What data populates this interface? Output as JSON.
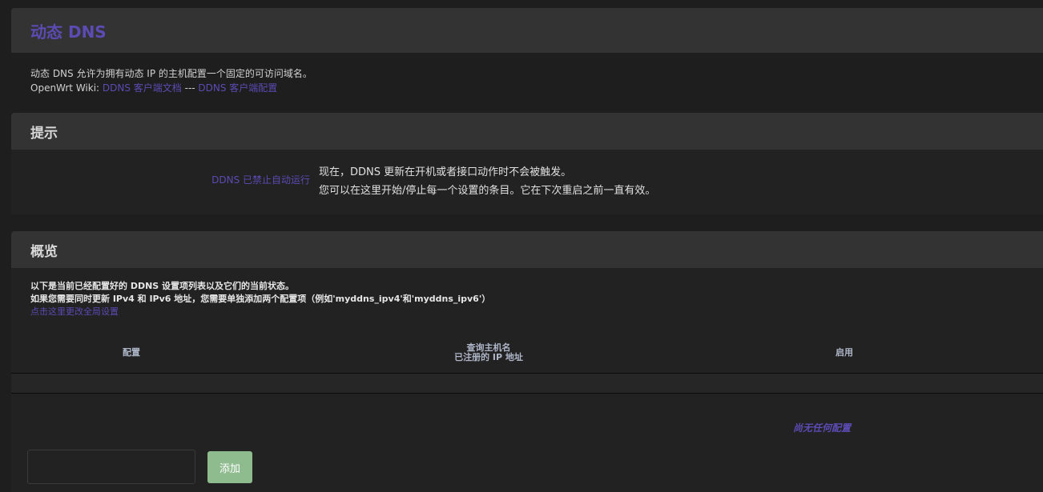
{
  "page": {
    "title": "动态 DNS",
    "description_line1": "动态 DNS 允许为拥有动态 IP 的主机配置一个固定的可访问域名。",
    "wiki_prefix": "OpenWrt Wiki: ",
    "wiki_link1": "DDNS 客户端文档",
    "wiki_separator": " --- ",
    "wiki_link2": "DDNS 客户端配置"
  },
  "notice": {
    "heading": "提示",
    "label": "DDNS 已禁止自动运行",
    "line1": "现在，DDNS 更新在开机或者接口动作时不会被触发。",
    "line2": "您可以在这里开始/停止每一个设置的条目。它在下次重启之前一直有效。"
  },
  "overview": {
    "heading": "概览",
    "desc_line1": "以下是当前已经配置好的 DDNS 设置项列表以及它们的当前状态。",
    "desc_line2": "如果您需要同时更新 IPv4 和 IPv6 地址，您需要单独添加两个配置项（例如'myddns_ipv4'和'myddns_ipv6'）",
    "global_settings_link": "点击这里更改全局设置",
    "columns": {
      "config": "配置",
      "hostname_line1": "查询主机名",
      "hostname_line2": "已注册的 IP 地址",
      "enabled": "启用"
    },
    "empty_message": "尚无任何配置",
    "add_input_value": "",
    "add_button": "添加"
  },
  "colors": {
    "accent": "#5b4bb3",
    "add_button": "#8fbc8f"
  }
}
